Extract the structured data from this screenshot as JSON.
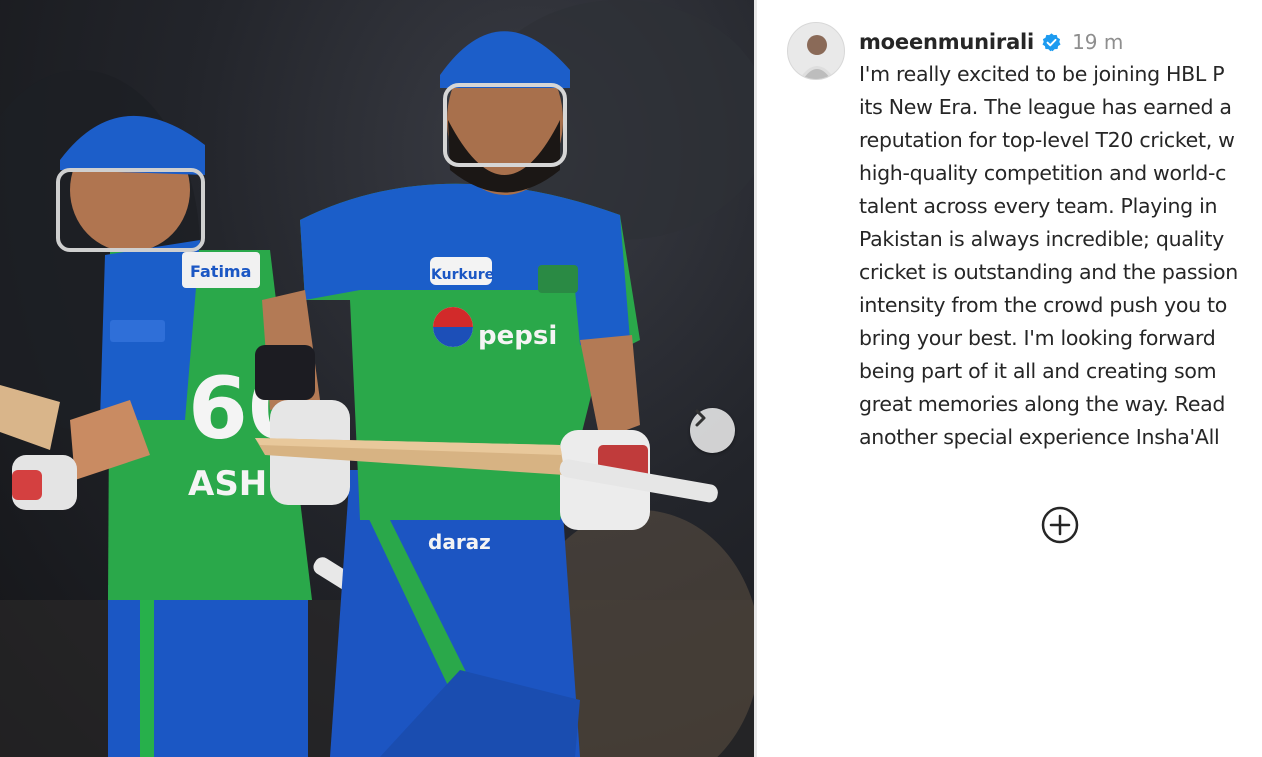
{
  "post": {
    "username": "moeenmunirali",
    "time": "19 m",
    "caption_lines": [
      "I'm really excited to be joining HBL P",
      "its New Era. The league has earned a",
      "reputation for top-level T20 cricket, w",
      "high-quality competition and world-c",
      "talent across every team. Playing in",
      "Pakistan is always incredible; quality",
      "cricket is outstanding and the passion",
      "intensity from the crowd push you to",
      "bring your best. I'm looking forward",
      "being part of it all and creating som",
      "great memories along the way. Read",
      "another special experience Insha'All"
    ]
  },
  "photo": {
    "sponsor_front": "pepsi",
    "sponsor_chest": "Kurkure",
    "sponsor_shorts": "daraz",
    "back_jersey_number": "60",
    "back_jersey_name": "ASH",
    "shoulder_sponsor": "Fatima"
  },
  "icons": {
    "next": "chevron-right-icon",
    "more": "plus-circle-icon",
    "verified": "verified-badge-icon"
  },
  "colors": {
    "jersey_blue": "#1a5cc8",
    "jersey_green": "#2aa84a",
    "verified_blue": "#1d9bf0"
  }
}
